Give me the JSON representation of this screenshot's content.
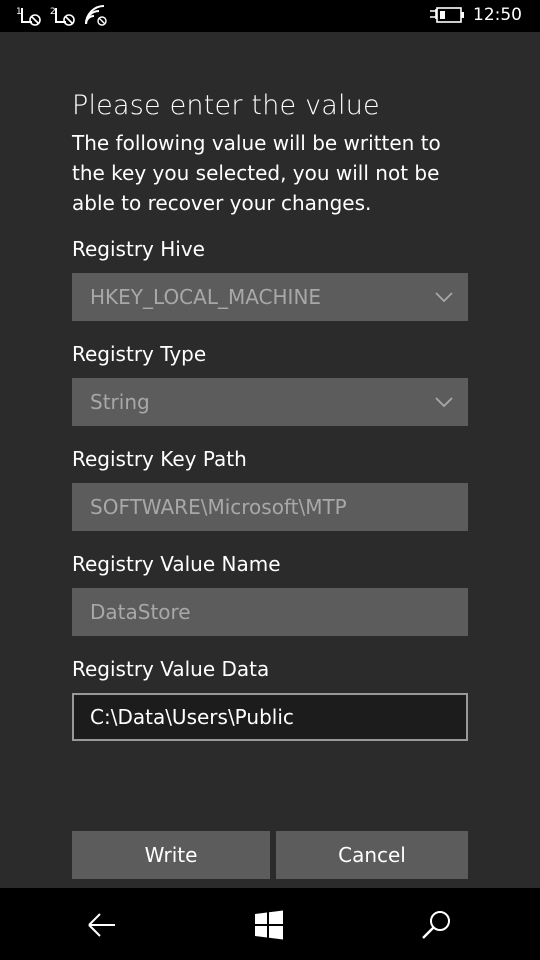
{
  "status": {
    "sim1_label": "1",
    "sim2_label": "2",
    "time": "12:50",
    "icons": [
      "sim1-no-signal-icon",
      "sim2-no-signal-icon",
      "wifi-icon",
      "battery-charging-icon"
    ]
  },
  "dialog": {
    "title": "Please enter the value",
    "description": "The following value will be written to the key you selected, you will not be able to recover your changes.",
    "hive_label": "Registry Hive",
    "hive_value": "HKEY_LOCAL_MACHINE",
    "type_label": "Registry Type",
    "type_value": "String",
    "path_label": "Registry Key Path",
    "path_value": "SOFTWARE\\Microsoft\\MTP",
    "name_label": "Registry Value Name",
    "name_value": "DataStore",
    "data_label": "Registry Value Data",
    "data_value": "C:\\Data\\Users\\Public",
    "write_label": "Write",
    "cancel_label": "Cancel"
  },
  "nav": {
    "icons": [
      "back-arrow-icon",
      "windows-start-icon",
      "search-icon"
    ]
  }
}
